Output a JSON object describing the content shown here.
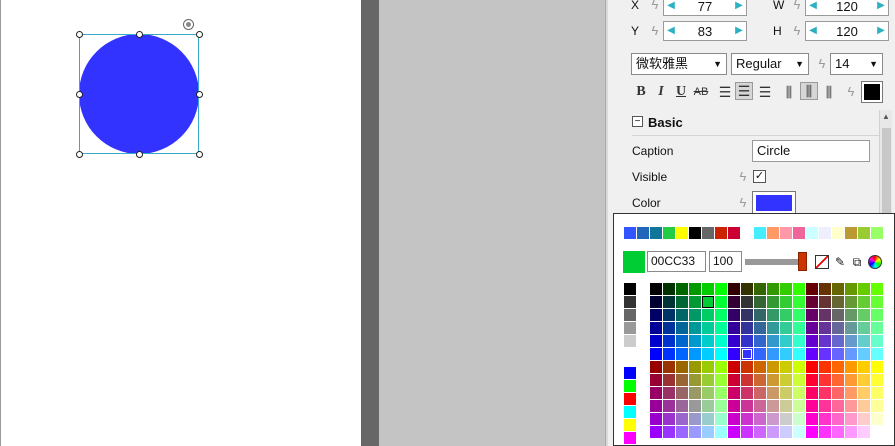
{
  "canvas": {
    "shape_color": "#3333ff"
  },
  "properties": {
    "x_label": "X",
    "x_value": "77",
    "y_label": "Y",
    "y_value": "83",
    "w_label": "W",
    "w_value": "120",
    "h_label": "H",
    "h_value": "120",
    "font_family": "微软雅黑",
    "font_style": "Regular",
    "font_size": "14",
    "text_color": "#000000",
    "toolbar": {
      "bold": "B",
      "italic": "I",
      "underline": "U",
      "strikethrough": "AB"
    },
    "section_title": "Basic",
    "caption_label": "Caption",
    "caption_value": "Circle",
    "visible_label": "Visible",
    "visible_checked": true,
    "color_label": "Color",
    "color_value": "#3333ff"
  },
  "color_picker": {
    "current_color": "#00cc33",
    "hex_value": "00CC33",
    "alpha_value": "100",
    "recent_colors": [
      "#3355ff",
      "#2266bb",
      "#117799",
      "#22cc44",
      "#ffff00",
      "#000000",
      "#666666",
      "#cc2200",
      "#cc0033",
      "#ffffff",
      "#44eeff",
      "#ff9966",
      "#ff99aa",
      "#ee6699",
      "#ccffff",
      "#eeeeff",
      "#ffffcc",
      "#bb9933",
      "#99cc33",
      "#99ff66"
    ],
    "gray_column": [
      "#000000",
      "#333333",
      "#666666",
      "#999999",
      "#cccccc",
      "#ffffff",
      "#0000ff",
      "#00ff00",
      "#ff0000",
      "#00ffff",
      "#ffff00",
      "#ff00ff"
    ]
  }
}
